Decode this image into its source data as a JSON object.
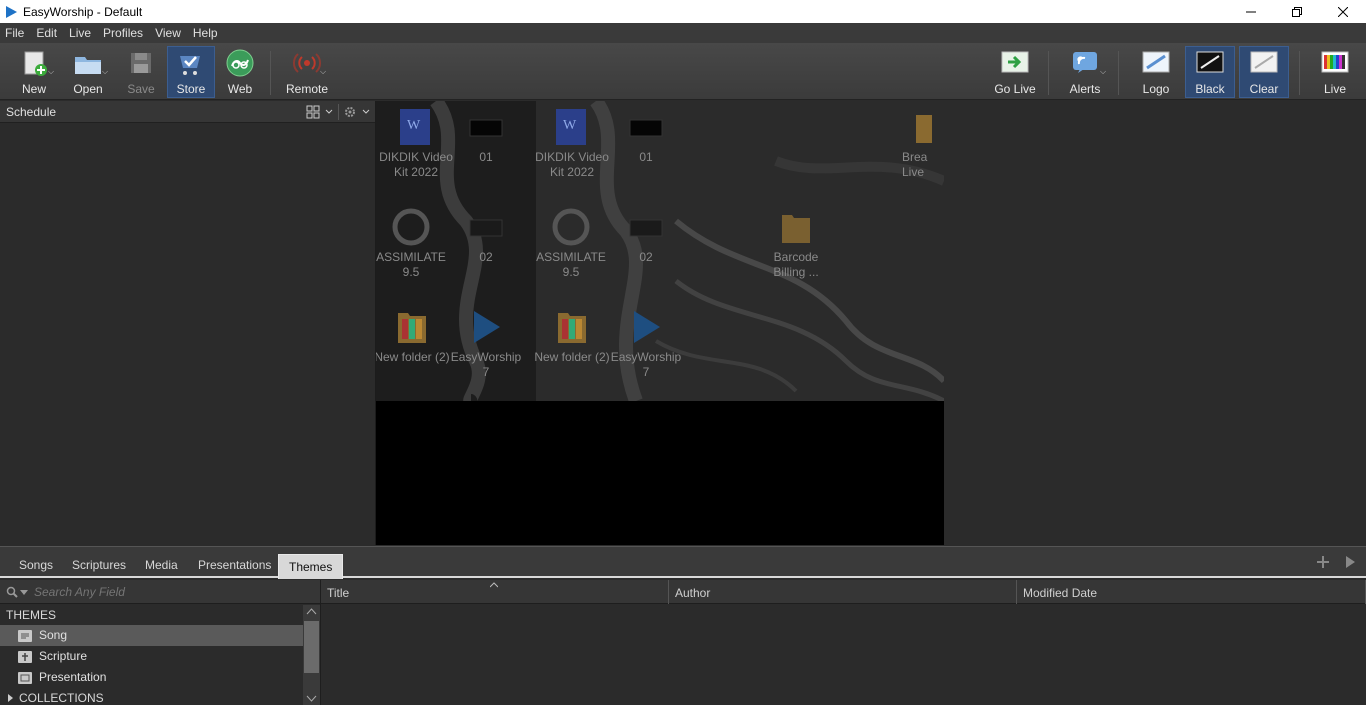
{
  "window": {
    "title": "EasyWorship - Default"
  },
  "menu": [
    "File",
    "Edit",
    "Live",
    "Profiles",
    "View",
    "Help"
  ],
  "toolbar": {
    "new": "New",
    "open": "Open",
    "save": "Save",
    "store": "Store",
    "web": "Web",
    "remote": "Remote",
    "go_live": "Go Live",
    "alerts": "Alerts",
    "logo": "Logo",
    "black": "Black",
    "clear": "Clear",
    "live": "Live"
  },
  "schedule": {
    "title": "Schedule"
  },
  "preview_icons": [
    {
      "label": "DIKDIK Video Kit 2022"
    },
    {
      "label": "01"
    },
    {
      "label": "DIKDIK Video Kit 2022"
    },
    {
      "label": "01"
    },
    {
      "label": "Brea Live"
    },
    {
      "label": "ASSIMILATE 9.5"
    },
    {
      "label": "02"
    },
    {
      "label": "ASSIMILATE 9.5"
    },
    {
      "label": "02"
    },
    {
      "label": "Barcode Billing ..."
    },
    {
      "label": "New folder (2)"
    },
    {
      "label": "EasyWorship 7"
    },
    {
      "label": "New folder (2)"
    },
    {
      "label": "EasyWorship 7"
    }
  ],
  "library_tabs": [
    "Songs",
    "Scriptures",
    "Media",
    "Presentations",
    "Themes"
  ],
  "library_active_tab": "Themes",
  "search": {
    "placeholder": "Search Any Field"
  },
  "tree": {
    "themes_header": "THEMES",
    "items": [
      "Song",
      "Scripture",
      "Presentation"
    ],
    "collections_header": "COLLECTIONS"
  },
  "columns": [
    "Title",
    "Author",
    "Modified Date"
  ],
  "colors": {
    "accent": "#2f4a73",
    "panel": "#2b2b2b",
    "toolbar": "#444444"
  }
}
